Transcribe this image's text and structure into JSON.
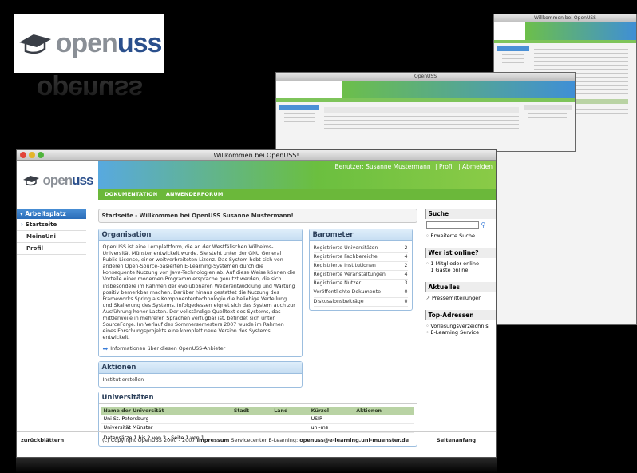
{
  "brand": {
    "open": "open",
    "uss": "uss"
  },
  "bg_windows": {
    "win2_title": "OpenUSS",
    "win3_title": "Willkommen bei OpenUSS"
  },
  "window": {
    "title": "Willkommen bei OpenUSS!",
    "user_label": "Benutzer: Susanne Mustermann",
    "profile_link": "| Profil",
    "logout_link": "| Abmelden",
    "nav": [
      "DOKUMENTATION",
      "ANWENDERFORUM"
    ]
  },
  "sidebar": {
    "header": "Arbeitsplatz",
    "items": [
      "Startseite",
      "MeineUni",
      "Profil"
    ]
  },
  "breadcrumb": "Startseite - Willkommen bei OpenUSS Susanne Mustermann!",
  "organisation": {
    "title": "Organisation",
    "text": "OpenUSS ist eine Lernplattform, die an der Westfälischen Wilhelms-Universität Münster entwickelt wurde. Sie steht unter der GNU General Public License, einer weitverbreiteten Lizenz. Das System hebt sich von anderen Open-Source-basierten E-Learning-Systemen durch die konsequente Nutzung von Java-Technologien ab. Auf diese Weise können die Vorteile einer modernen Programmiersprache genutzt werden, die sich insbesondere im Rahmen der evolutionären Weiterentwicklung und Wartung positiv bemerkbar machen. Darüber hinaus gestattet die Nutzung des Frameworks Spring als Komponententechnologie die beliebige Verteilung und Skalierung des Systems. Infolgedessen eignet sich das System auch zur Ausführung hoher Lasten. Der vollständige Quelltext des Systems, das mittlerweile in mehreren Sprachen verfügbar ist, befindet sich unter SourceForge. Im Verlauf des Sommersemesters 2007 wurde im Rahmen eines Forschungsprojekts eine komplett neue Version des Systems entwickelt.",
    "info_link": "Informationen über diesen OpenUSS-Anbieter"
  },
  "barometer": {
    "title": "Barometer",
    "rows": [
      {
        "label": "Registrierte Universitäten",
        "value": "2"
      },
      {
        "label": "Registrierte Fachbereiche",
        "value": "4"
      },
      {
        "label": "Registrierte Institutionen",
        "value": "2"
      },
      {
        "label": "Registrierte Veranstaltungen",
        "value": "4"
      },
      {
        "label": "Registrierte Nutzer",
        "value": "3"
      },
      {
        "label": "Veröffentlichte Dokumente",
        "value": "0"
      },
      {
        "label": "Diskussionsbeiträge",
        "value": "0"
      }
    ]
  },
  "aktionen": {
    "title": "Aktionen",
    "item": "Institut erstellen"
  },
  "universitaeten": {
    "title": "Universitäten",
    "headers": [
      "Name der Universität",
      "Stadt",
      "Land",
      "Kürzel",
      "Aktionen"
    ],
    "rows": [
      [
        "Uni St. Petersburg",
        "",
        "",
        "USIP",
        ""
      ],
      [
        "Universität Münster",
        "",
        "",
        "uni-ms",
        ""
      ]
    ],
    "footer": "Datensätze 1 bis 2 von 2 - Seite 1 von 1"
  },
  "right": {
    "suche_title": "Suche",
    "erweiterte": "Erweiterte Suche",
    "online_title": "Wer ist online?",
    "online": [
      "1 Mitglieder online",
      "1 Gäste online"
    ],
    "aktuelles_title": "Aktuelles",
    "presse": "Pressemitteilungen",
    "top_title": "Top-Adressen",
    "top": [
      "Vorlesungsverzeichnis",
      "E-Learning Service"
    ]
  },
  "footer": {
    "prev": "zurückblättern",
    "copy": "(c) Copyright OpenUSS 2000 - 2007",
    "impressum": "Impressum",
    "service": "Servicecenter E-Learning:",
    "email": "openuss@e-learning.uni-muenster.de",
    "top": "Seitenanfang"
  }
}
